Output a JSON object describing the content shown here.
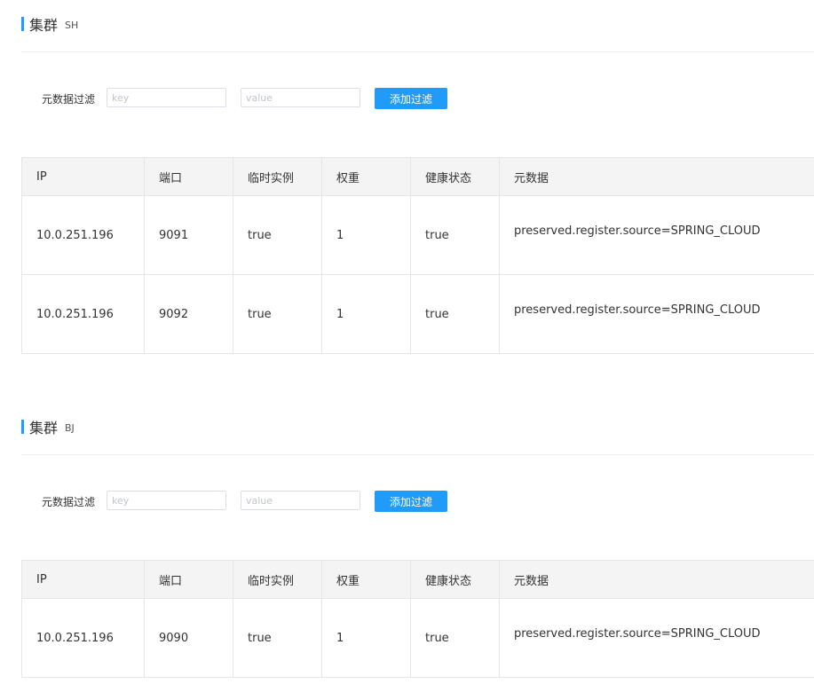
{
  "clusters": [
    {
      "title": "集群",
      "name": "SH",
      "filter": {
        "label": "元数据过滤",
        "key_placeholder": "key",
        "value_placeholder": "value",
        "button_label": "添加过滤"
      },
      "table": {
        "columns": [
          "IP",
          "端口",
          "临时实例",
          "权重",
          "健康状态",
          "元数据"
        ],
        "rows": [
          {
            "ip": "10.0.251.196",
            "port": "9091",
            "ephemeral": "true",
            "weight": "1",
            "healthy": "true",
            "metadata": "preserved.register.source=SPRING_CLOUD"
          },
          {
            "ip": "10.0.251.196",
            "port": "9092",
            "ephemeral": "true",
            "weight": "1",
            "healthy": "true",
            "metadata": "preserved.register.source=SPRING_CLOUD"
          }
        ]
      }
    },
    {
      "title": "集群",
      "name": "BJ",
      "filter": {
        "label": "元数据过滤",
        "key_placeholder": "key",
        "value_placeholder": "value",
        "button_label": "添加过滤"
      },
      "table": {
        "columns": [
          "IP",
          "端口",
          "临时实例",
          "权重",
          "健康状态",
          "元数据"
        ],
        "rows": [
          {
            "ip": "10.0.251.196",
            "port": "9090",
            "ephemeral": "true",
            "weight": "1",
            "healthy": "true",
            "metadata": "preserved.register.source=SPRING_CLOUD"
          }
        ]
      }
    }
  ],
  "colors": {
    "accent": "#209bfa",
    "header_bg": "#f4f4f5",
    "border": "#e6e6e6"
  }
}
